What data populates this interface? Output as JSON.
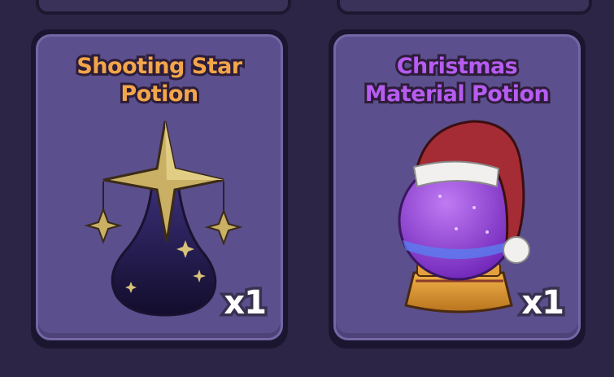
{
  "items": [
    {
      "title_lines": [
        "Shooting Star",
        "Potion"
      ],
      "quantity": "x1",
      "title_color": "#f2a54a",
      "icon": "shooting-star-potion-icon"
    },
    {
      "title_lines": [
        "Christmas",
        "Material Potion"
      ],
      "quantity": "x1",
      "title_color": "#b65cf0",
      "icon": "christmas-snow-globe-potion-icon"
    }
  ]
}
